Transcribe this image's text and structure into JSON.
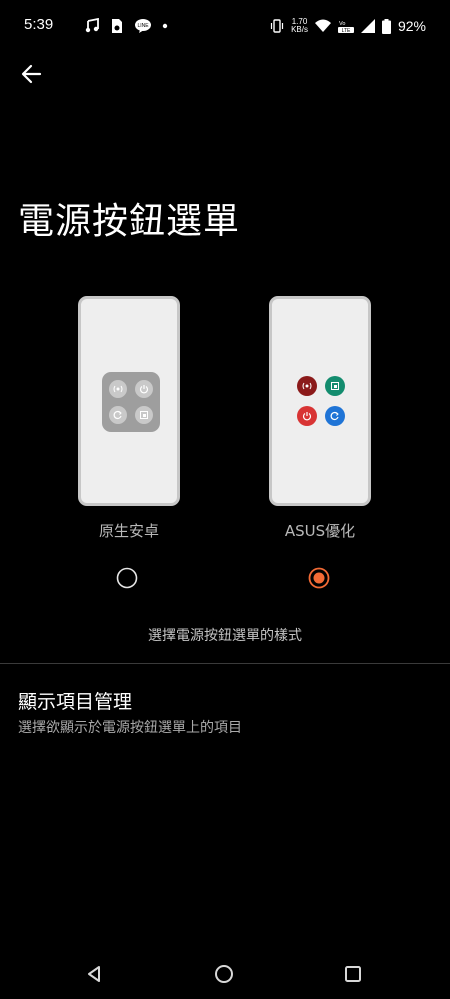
{
  "status": {
    "time": "5:39",
    "net_speed_value": "1.70",
    "net_speed_unit": "KB/s",
    "battery": "92%",
    "left_icons": [
      "music-note-icon",
      "notification-app-icon",
      "line-app-icon",
      "dot-icon"
    ],
    "right_icons": [
      "vibrate-icon",
      "wifi-icon",
      "volte-icon",
      "signal-icon",
      "battery-icon"
    ]
  },
  "header": {
    "title": "電源按鈕選單"
  },
  "options": [
    {
      "label": "原生安卓",
      "selected": false
    },
    {
      "label": "ASUS優化",
      "selected": true
    }
  ],
  "style_description": "選擇電源按鈕選單的樣式",
  "manage": {
    "title": "顯示項目管理",
    "subtitle": "選擇欲顯示於電源按鈕選單上的項目"
  },
  "colors": {
    "accent": "#f26a35",
    "asus_emergency": "#8b1a1a",
    "asus_screenshot": "#138c6e",
    "asus_power": "#d83434",
    "asus_restart": "#1f74d6"
  }
}
